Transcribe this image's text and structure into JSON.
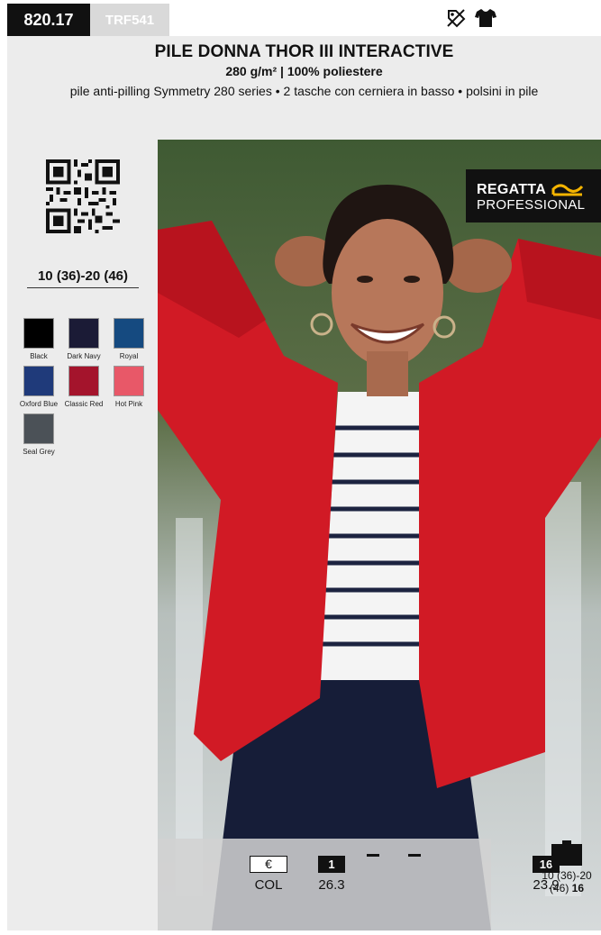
{
  "product": {
    "code": "820.17",
    "reference": "TRF541",
    "title": "PILE DONNA THOR III INTERACTIVE",
    "subtitle": "280 g/m² | 100% poliestere",
    "features": "pile anti-pilling Symmetry 280 series • 2 tasche con cerniera in basso • polsini in pile"
  },
  "icons": [
    "no-print-icon",
    "tshirt-icon",
    "qr-code-icon",
    "carton-box-icon"
  ],
  "sizes": {
    "range": "10 (36)-20 (46)"
  },
  "colors": [
    {
      "name": "Black",
      "hex": "#000000"
    },
    {
      "name": "Dark Navy",
      "hex": "#1b1b36"
    },
    {
      "name": "Royal",
      "hex": "#154a80"
    },
    {
      "name": "Oxford Blue",
      "hex": "#1f3a7a"
    },
    {
      "name": "Classic Red",
      "hex": "#a4142c"
    },
    {
      "name": "Hot Pink",
      "hex": "#e85868"
    },
    {
      "name": "Seal Grey",
      "hex": "#4b5157"
    }
  ],
  "brand": {
    "line1": "REGATTA",
    "line2": "PROFESSIONAL",
    "accent": "#f5b400"
  },
  "pricing": {
    "currency_symbol": "€",
    "color_label": "COL",
    "tiers": [
      {
        "qty": "1",
        "price": "26.3"
      },
      {
        "qty": "16",
        "price": "23.9"
      }
    ]
  },
  "carton": {
    "sizes": "10 (36)-20",
    "sizes_end": "(46)",
    "qty": "16"
  }
}
